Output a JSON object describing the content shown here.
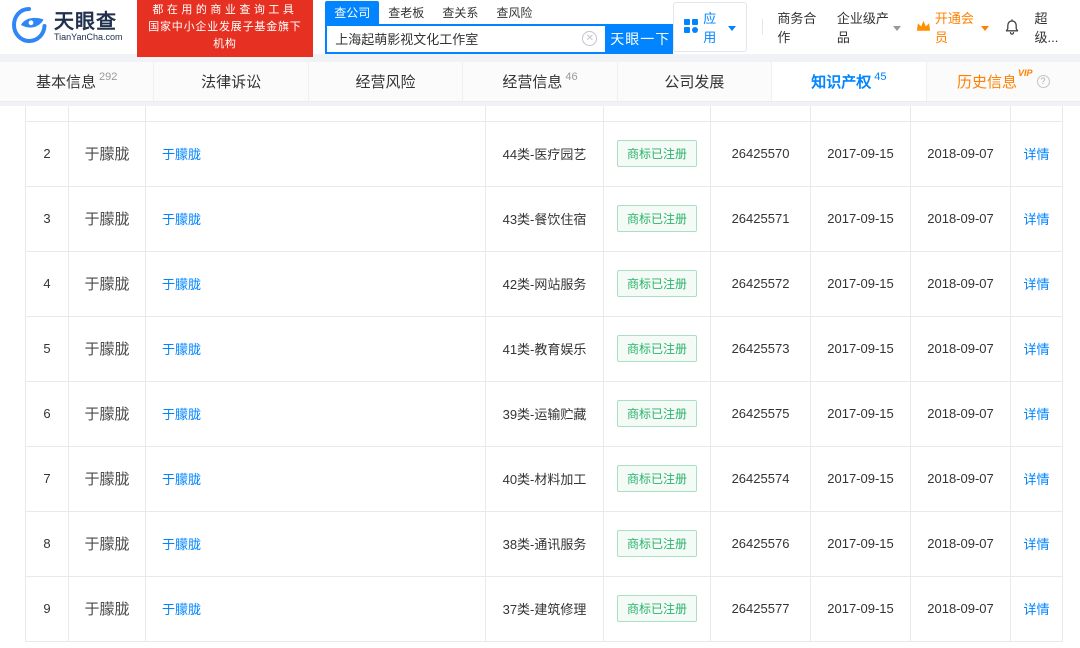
{
  "colors": {
    "brand_blue": "#0084ff",
    "vip_orange": "#ff8000",
    "badge_green": "#2bb36b",
    "banner_red": "#e63022"
  },
  "header": {
    "logo_title": "天眼查",
    "logo_subtitle": "TianYanCha.com",
    "banner_line1": "都在用的商业查询工具",
    "banner_line2": "国家中小企业发展子基金旗下机构",
    "search_tabs": [
      "查公司",
      "查老板",
      "查关系",
      "查风险"
    ],
    "search_value": "上海起萌影视文化工作室",
    "search_button": "天眼一下",
    "menu": {
      "apps": "应用",
      "cooperation": "商务合作",
      "enterprise": "企业级产品",
      "vip": "开通会员",
      "user": "超级..."
    }
  },
  "tabs": [
    {
      "label": "基本信息",
      "count": "292"
    },
    {
      "label": "法律诉讼",
      "count": ""
    },
    {
      "label": "经营风险",
      "count": ""
    },
    {
      "label": "经营信息",
      "count": "46"
    },
    {
      "label": "公司发展",
      "count": ""
    },
    {
      "label": "知识产权",
      "count": "45"
    },
    {
      "label": "历史信息",
      "count": "",
      "vip_badge": "VIP"
    }
  ],
  "table": {
    "rows": [
      {
        "idx": "2",
        "owner": "于朦胧",
        "link": "于朦胧",
        "category": "44类-医疗园艺",
        "status": "商标已注册",
        "reg_no": "26425570",
        "apply_date": "2017-09-15",
        "reg_date": "2018-09-07",
        "action": "详情"
      },
      {
        "idx": "3",
        "owner": "于朦胧",
        "link": "于朦胧",
        "category": "43类-餐饮住宿",
        "status": "商标已注册",
        "reg_no": "26425571",
        "apply_date": "2017-09-15",
        "reg_date": "2018-09-07",
        "action": "详情"
      },
      {
        "idx": "4",
        "owner": "于朦胧",
        "link": "于朦胧",
        "category": "42类-网站服务",
        "status": "商标已注册",
        "reg_no": "26425572",
        "apply_date": "2017-09-15",
        "reg_date": "2018-09-07",
        "action": "详情"
      },
      {
        "idx": "5",
        "owner": "于朦胧",
        "link": "于朦胧",
        "category": "41类-教育娱乐",
        "status": "商标已注册",
        "reg_no": "26425573",
        "apply_date": "2017-09-15",
        "reg_date": "2018-09-07",
        "action": "详情"
      },
      {
        "idx": "6",
        "owner": "于朦胧",
        "link": "于朦胧",
        "category": "39类-运输贮藏",
        "status": "商标已注册",
        "reg_no": "26425575",
        "apply_date": "2017-09-15",
        "reg_date": "2018-09-07",
        "action": "详情"
      },
      {
        "idx": "7",
        "owner": "于朦胧",
        "link": "于朦胧",
        "category": "40类-材料加工",
        "status": "商标已注册",
        "reg_no": "26425574",
        "apply_date": "2017-09-15",
        "reg_date": "2018-09-07",
        "action": "详情"
      },
      {
        "idx": "8",
        "owner": "于朦胧",
        "link": "于朦胧",
        "category": "38类-通讯服务",
        "status": "商标已注册",
        "reg_no": "26425576",
        "apply_date": "2017-09-15",
        "reg_date": "2018-09-07",
        "action": "详情"
      },
      {
        "idx": "9",
        "owner": "于朦胧",
        "link": "于朦胧",
        "category": "37类-建筑修理",
        "status": "商标已注册",
        "reg_no": "26425577",
        "apply_date": "2017-09-15",
        "reg_date": "2018-09-07",
        "action": "详情"
      }
    ]
  }
}
